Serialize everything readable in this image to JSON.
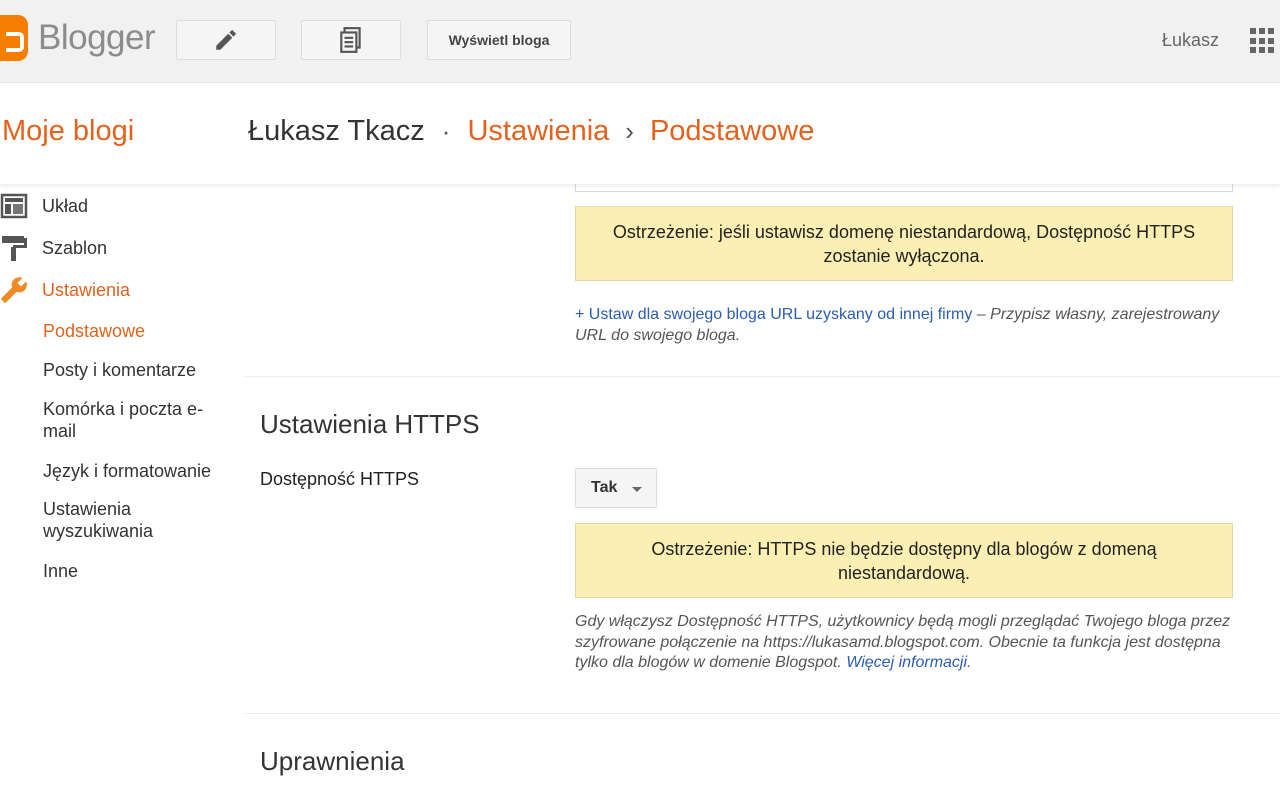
{
  "app": {
    "logo_text": "Blogger",
    "user_name": "Łukasz",
    "view_blog_label": "Wyświetl bloga"
  },
  "header": {
    "my_blogs": "Moje blogi",
    "blog_name": "Łukasz Tkacz",
    "dot": "·",
    "settings": "Ustawienia",
    "sep": "›",
    "current": "Podstawowe"
  },
  "sidebar": {
    "items": [
      {
        "label": "Układ",
        "icon": "layout-icon"
      },
      {
        "label": "Szablon",
        "icon": "paint-roller-icon"
      },
      {
        "label": "Ustawienia",
        "icon": "wrench-icon"
      }
    ],
    "subitems": [
      {
        "label": "Podstawowe"
      },
      {
        "label": "Posty i komentarze"
      },
      {
        "label": "Komórka i poczta e-mail"
      },
      {
        "label": "Język i formatowanie"
      },
      {
        "label": "Ustawienia wyszukiwania"
      },
      {
        "label": "Inne"
      }
    ]
  },
  "domain": {
    "warning": "Ostrzeżenie: jeśli ustawisz domenę niestandardową, Dostępność HTTPS zostanie wyłączona.",
    "link": "+ Ustaw dla swojego bloga URL uzyskany od innej firmy",
    "link_desc": " – Przypisz własny, zarejestrowany URL do swojego bloga."
  },
  "https": {
    "title": "Ustawienia HTTPS",
    "label": "Dostępność HTTPS",
    "select_value": "Tak",
    "warning": "Ostrzeżenie: HTTPS nie będzie dostępny dla blogów z domeną niestandardową.",
    "note": "Gdy włączysz Dostępność HTTPS, użytkownicy będą mogli przeglądać Twojego bloga przez szyfrowane połączenie na https://lukasamd.blogspot.com. Obecnie ta funkcja jest dostępna tylko dla blogów w domenie Blogspot. ",
    "more_link": "Więcej informacji",
    "note_end": "."
  },
  "permissions": {
    "title": "Uprawnienia"
  },
  "colors": {
    "accent": "#e5611c",
    "link": "#2a5db0",
    "warning_bg": "#fcefb3"
  }
}
